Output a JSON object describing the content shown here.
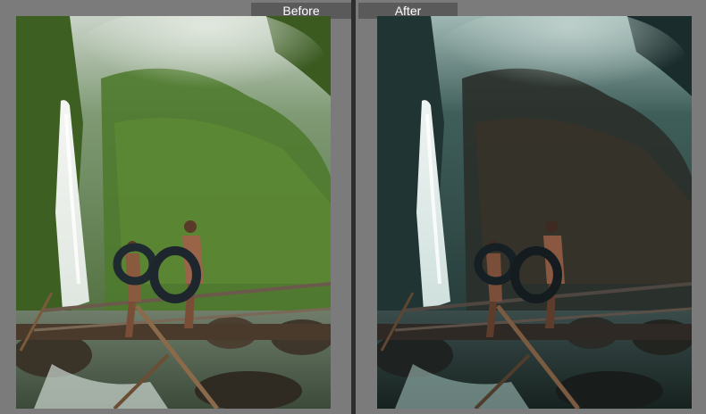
{
  "compare": {
    "before_label": "Before",
    "after_label": "After"
  },
  "colors": {
    "background": "#7b7b7b",
    "divider": "#2e2e2e",
    "label_background": "#5a5a5a",
    "label_text": "#ffffff",
    "before_foliage": "#3f6b2a",
    "after_foliage": "#1f3a3a"
  }
}
